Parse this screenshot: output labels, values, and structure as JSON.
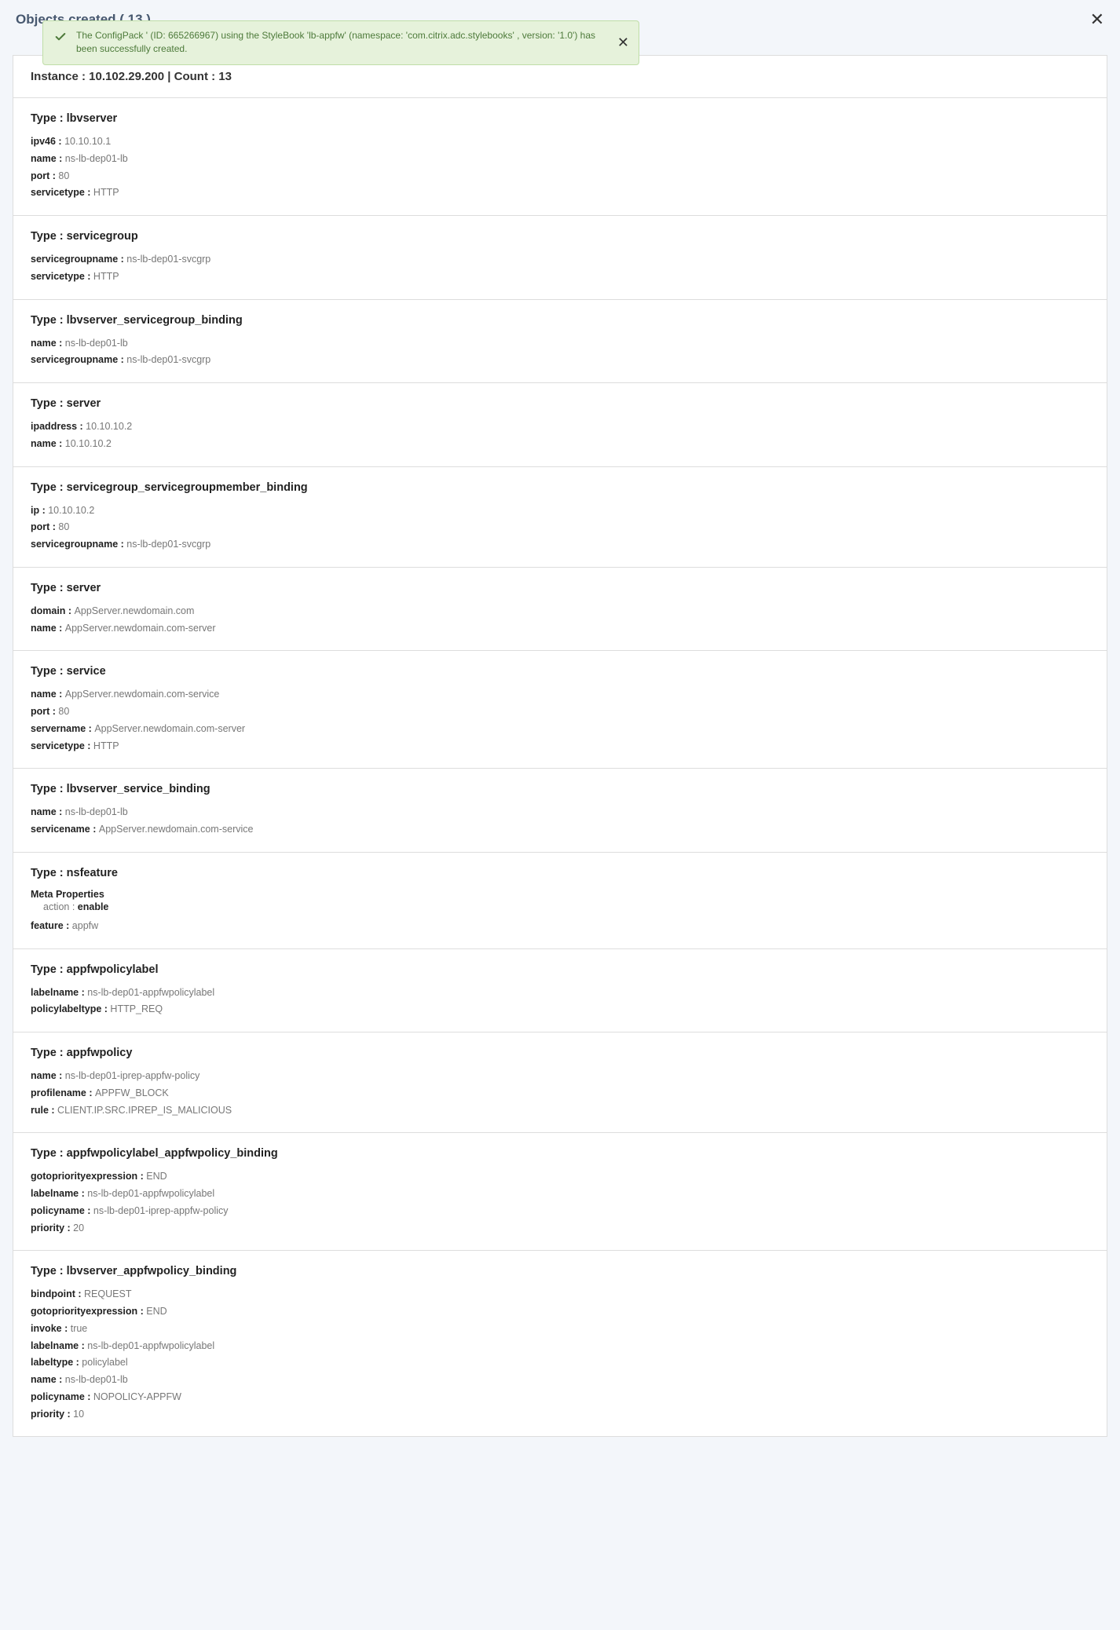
{
  "header": {
    "title": "Objects created ( 13 )"
  },
  "toast": {
    "message": "The ConfigPack ' (ID: 665266967) using the StyleBook 'lb-appfw' (namespace: 'com.citrix.adc.stylebooks' , version: '1.0') has been successfully created."
  },
  "instance_bar": "Instance : 10.102.29.200  |  Count : 13",
  "labels": {
    "type_prefix": "Type : ",
    "meta_properties": "Meta Properties"
  },
  "cards": [
    {
      "type": "lbvserver",
      "props": [
        {
          "k": "ipv46 : ",
          "v": "10.10.10.1"
        },
        {
          "k": "name : ",
          "v": "ns-lb-dep01-lb"
        },
        {
          "k": "port : ",
          "v": "80"
        },
        {
          "k": "servicetype : ",
          "v": "HTTP"
        }
      ]
    },
    {
      "type": "servicegroup",
      "props": [
        {
          "k": "servicegroupname : ",
          "v": "ns-lb-dep01-svcgrp"
        },
        {
          "k": "servicetype : ",
          "v": "HTTP"
        }
      ]
    },
    {
      "type": "lbvserver_servicegroup_binding",
      "props": [
        {
          "k": "name : ",
          "v": "ns-lb-dep01-lb"
        },
        {
          "k": "servicegroupname : ",
          "v": "ns-lb-dep01-svcgrp"
        }
      ]
    },
    {
      "type": "server",
      "props": [
        {
          "k": "ipaddress : ",
          "v": "10.10.10.2"
        },
        {
          "k": "name : ",
          "v": "10.10.10.2"
        }
      ]
    },
    {
      "type": "servicegroup_servicegroupmember_binding",
      "props": [
        {
          "k": "ip : ",
          "v": "10.10.10.2"
        },
        {
          "k": "port : ",
          "v": "80"
        },
        {
          "k": "servicegroupname : ",
          "v": "ns-lb-dep01-svcgrp"
        }
      ]
    },
    {
      "type": "server",
      "props": [
        {
          "k": "domain : ",
          "v": "AppServer.newdomain.com"
        },
        {
          "k": "name : ",
          "v": "AppServer.newdomain.com-server"
        }
      ]
    },
    {
      "type": "service",
      "props": [
        {
          "k": "name : ",
          "v": "AppServer.newdomain.com-service"
        },
        {
          "k": "port : ",
          "v": "80"
        },
        {
          "k": "servername : ",
          "v": "AppServer.newdomain.com-server"
        },
        {
          "k": "servicetype : ",
          "v": "HTTP"
        }
      ]
    },
    {
      "type": "lbvserver_service_binding",
      "props": [
        {
          "k": "name : ",
          "v": "ns-lb-dep01-lb"
        },
        {
          "k": "servicename : ",
          "v": "AppServer.newdomain.com-service"
        }
      ]
    },
    {
      "type": "nsfeature",
      "meta": {
        "k": "action : ",
        "v": "enable"
      },
      "props": [
        {
          "k": "feature : ",
          "v": "appfw"
        }
      ]
    },
    {
      "type": "appfwpolicylabel",
      "props": [
        {
          "k": "labelname : ",
          "v": "ns-lb-dep01-appfwpolicylabel"
        },
        {
          "k": "policylabeltype : ",
          "v": "HTTP_REQ"
        }
      ]
    },
    {
      "type": "appfwpolicy",
      "props": [
        {
          "k": "name : ",
          "v": "ns-lb-dep01-iprep-appfw-policy"
        },
        {
          "k": "profilename : ",
          "v": "APPFW_BLOCK"
        },
        {
          "k": "rule : ",
          "v": "CLIENT.IP.SRC.IPREP_IS_MALICIOUS"
        }
      ]
    },
    {
      "type": "appfwpolicylabel_appfwpolicy_binding",
      "props": [
        {
          "k": "gotopriorityexpression : ",
          "v": "END"
        },
        {
          "k": "labelname : ",
          "v": "ns-lb-dep01-appfwpolicylabel"
        },
        {
          "k": "policyname : ",
          "v": "ns-lb-dep01-iprep-appfw-policy"
        },
        {
          "k": "priority : ",
          "v": "20"
        }
      ]
    },
    {
      "type": "lbvserver_appfwpolicy_binding",
      "props": [
        {
          "k": "bindpoint : ",
          "v": "REQUEST"
        },
        {
          "k": "gotopriorityexpression : ",
          "v": "END"
        },
        {
          "k": "invoke : ",
          "v": "true"
        },
        {
          "k": "labelname : ",
          "v": "ns-lb-dep01-appfwpolicylabel"
        },
        {
          "k": "labeltype : ",
          "v": "policylabel"
        },
        {
          "k": "name : ",
          "v": "ns-lb-dep01-lb"
        },
        {
          "k": "policyname : ",
          "v": "NOPOLICY-APPFW"
        },
        {
          "k": "priority : ",
          "v": "10"
        }
      ]
    }
  ]
}
